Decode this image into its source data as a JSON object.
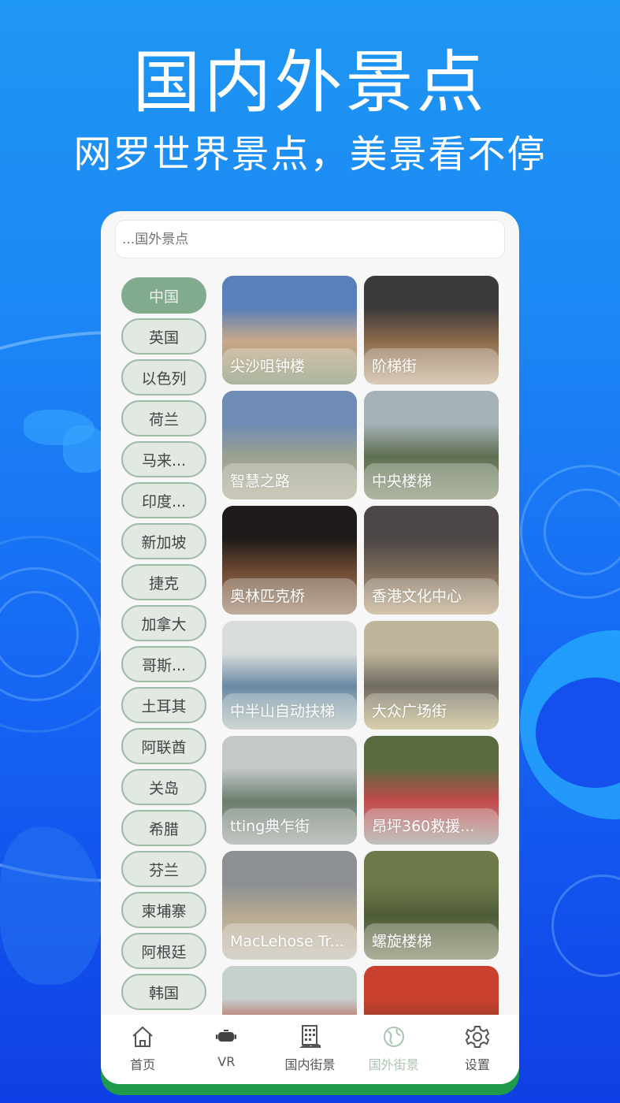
{
  "hero": {
    "title": "国内外景点",
    "subtitle": "网罗世界景点，美景看不停"
  },
  "search": {
    "placeholder": "...国外景点",
    "value": ""
  },
  "countries": [
    {
      "label": "中国",
      "selected": true
    },
    {
      "label": "英国",
      "selected": false
    },
    {
      "label": "以色列",
      "selected": false
    },
    {
      "label": "荷兰",
      "selected": false
    },
    {
      "label": "马来...",
      "selected": false
    },
    {
      "label": "印度...",
      "selected": false
    },
    {
      "label": "新加坡",
      "selected": false
    },
    {
      "label": "捷克",
      "selected": false
    },
    {
      "label": "加拿大",
      "selected": false
    },
    {
      "label": "哥斯...",
      "selected": false
    },
    {
      "label": "土耳其",
      "selected": false
    },
    {
      "label": "阿联酋",
      "selected": false
    },
    {
      "label": "关岛",
      "selected": false
    },
    {
      "label": "希腊",
      "selected": false
    },
    {
      "label": "芬兰",
      "selected": false
    },
    {
      "label": "柬埔寨",
      "selected": false
    },
    {
      "label": "阿根廷",
      "selected": false
    },
    {
      "label": "韩国",
      "selected": false
    }
  ],
  "spots": [
    {
      "name": "尖沙咀钟楼",
      "colors": [
        "#5b7fb8",
        "#c9a98a",
        "#8b9a7a"
      ]
    },
    {
      "name": "阶梯街",
      "colors": [
        "#3d3a3c",
        "#8a6a4a",
        "#c9b79a"
      ]
    },
    {
      "name": "智慧之路",
      "colors": [
        "#6f8bb6",
        "#9aa08f",
        "#b6b39f"
      ]
    },
    {
      "name": "中央楼梯",
      "colors": [
        "#a7b2b8",
        "#5f6f52",
        "#8e9a7c"
      ]
    },
    {
      "name": "奥林匹克桥",
      "colors": [
        "#1e1b1a",
        "#6d4a32",
        "#a58b72"
      ]
    },
    {
      "name": "香港文化中心",
      "colors": [
        "#4c4646",
        "#7a6a58",
        "#c1ad8c"
      ]
    },
    {
      "name": "中半山自动扶梯",
      "colors": [
        "#d9dcdc",
        "#6a8aa3",
        "#b9c5c0"
      ]
    },
    {
      "name": "大众广场街",
      "colors": [
        "#bdb49a",
        "#6e6a60",
        "#c9bd8a"
      ]
    },
    {
      "name": "tting典乍街",
      "colors": [
        "#c3c8c8",
        "#6b7e6f",
        "#a8aca8"
      ]
    },
    {
      "name": "昂坪360救援...",
      "colors": [
        "#5a6a3f",
        "#c44a4a",
        "#a7a7a2"
      ]
    },
    {
      "name": "MacLehose Tr...",
      "colors": [
        "#8c8f94",
        "#b8aa92",
        "#c9c3b6"
      ]
    },
    {
      "name": "螺旋楼梯",
      "colors": [
        "#6f7a4a",
        "#4f5c38",
        "#8b9070"
      ]
    },
    {
      "name": "",
      "colors": [
        "#c6d0cf",
        "#b84a3a",
        "#8a5a3a"
      ]
    },
    {
      "name": "",
      "colors": [
        "#c9402e",
        "#8b3b24",
        "#d9a05a"
      ]
    }
  ],
  "tabbar": {
    "items": [
      {
        "label": "首页",
        "icon": "home-icon",
        "active": false
      },
      {
        "label": "VR",
        "icon": "vr-headset-icon",
        "active": false
      },
      {
        "label": "国内街景",
        "icon": "building-icon",
        "active": false
      },
      {
        "label": "国外街景",
        "icon": "globe-icon",
        "active": true
      },
      {
        "label": "设置",
        "icon": "gear-icon",
        "active": false
      }
    ]
  },
  "colors": {
    "accent_green": "#82aa8d",
    "pill_bg": "#e2e9e3",
    "frame_green": "#1e9a4a",
    "inactive_tab": "#a9c4b2"
  }
}
